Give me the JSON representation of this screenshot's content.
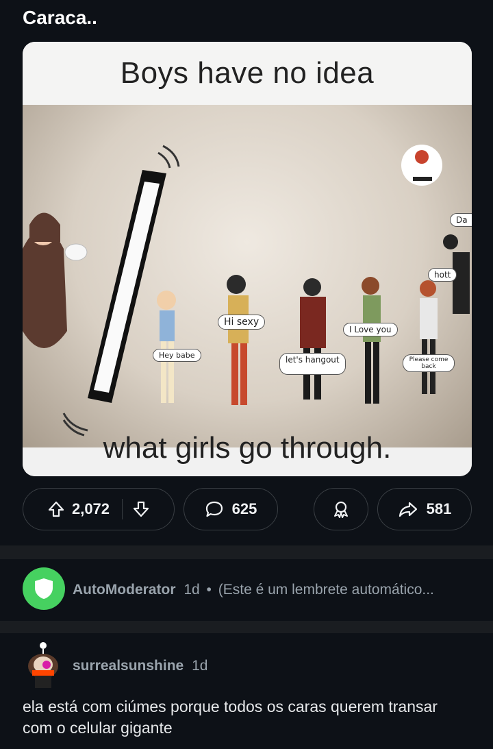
{
  "post": {
    "title": "Caraca..",
    "meme": {
      "top_text": "Boys have no idea",
      "bottom_text": "what girls go through.",
      "bubbles": [
        "Hey babe",
        "Hi sexy",
        "let's hangout",
        "I Love you",
        "Please come back",
        "hott",
        "Da"
      ]
    },
    "actions": {
      "upvotes": "2,072",
      "comments": "625",
      "shares": "581"
    }
  },
  "comments": [
    {
      "author": "AutoModerator",
      "age": "1d",
      "separator": "•",
      "preview": "(Este é um lembrete automático..."
    },
    {
      "author": "surrealsunshine",
      "age": "1d",
      "body": "ela está com ciúmes porque todos os caras querem transar com o celular gigante"
    }
  ],
  "colors": {
    "background": "#0d1117",
    "automod_green": "#46d160",
    "band": "#1a1d21"
  }
}
